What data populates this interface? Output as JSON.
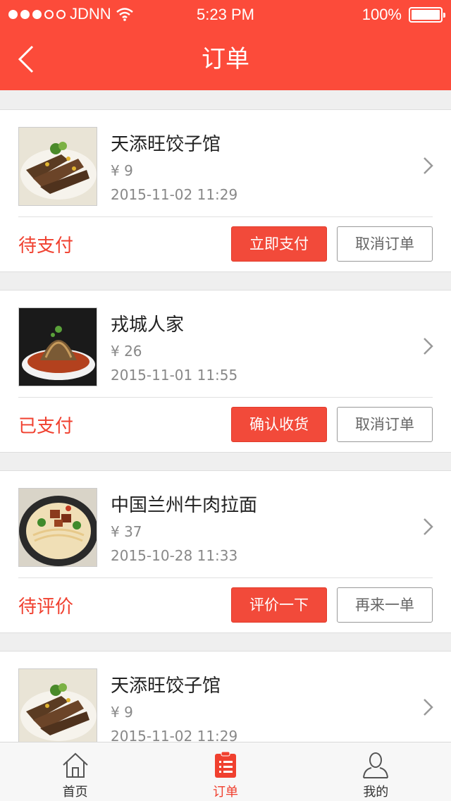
{
  "status_bar": {
    "carrier": "JDNN",
    "time": "5:23 PM",
    "battery": "100%"
  },
  "header": {
    "title": "订单"
  },
  "orders": [
    {
      "shop": "天添旺饺子馆",
      "price": "¥ 9",
      "datetime": "2015-11-02  11:29",
      "status": "待支付",
      "primary_action": "立即支付",
      "secondary_action": "取消订单"
    },
    {
      "shop": "戎城人家",
      "price": "¥ 26",
      "datetime": "2015-11-01 11:55",
      "status": "已支付",
      "primary_action": "确认收货",
      "secondary_action": "取消订单"
    },
    {
      "shop": "中国兰州牛肉拉面",
      "price": "¥ 37",
      "datetime": "2015-10-28  11:33",
      "status": "待评价",
      "primary_action": "评价一下",
      "secondary_action": "再来一单"
    },
    {
      "shop": "天添旺饺子馆",
      "price": "¥ 9",
      "datetime": "2015-11-02  11:29"
    }
  ],
  "tabbar": {
    "items": [
      {
        "label": "首页",
        "icon": "home-icon"
      },
      {
        "label": "订单",
        "icon": "order-list-icon",
        "active": true
      },
      {
        "label": "我的",
        "icon": "user-icon"
      }
    ]
  },
  "colors": {
    "brand": "#fc4b3a",
    "status_text": "#f0402f"
  }
}
